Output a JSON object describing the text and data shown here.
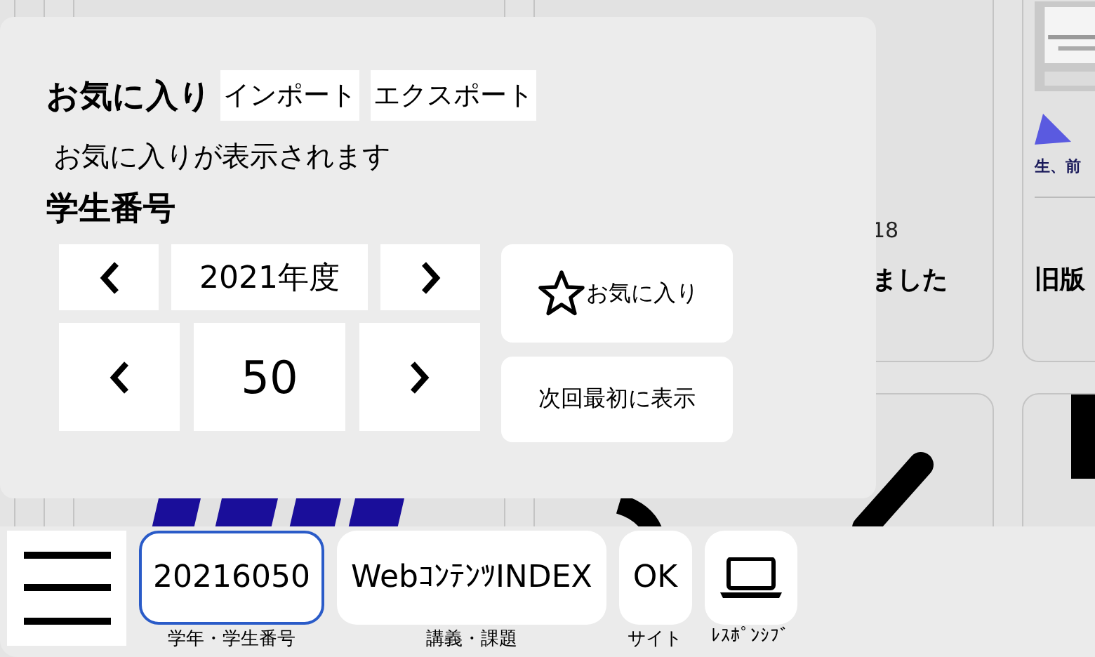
{
  "background": {
    "date_fragment": "18",
    "title_fragment": "ました",
    "card_title": "旧版",
    "caption_fragment": "生、前"
  },
  "favorites_panel": {
    "title": "お気に入り",
    "actions": [
      "インポート",
      "エクスポート"
    ],
    "message": "お気に入りが表示されます",
    "student_number": {
      "label": "学生番号",
      "year": "2021年度",
      "number": "50"
    },
    "favorite_button": "お気に入り",
    "show_first_button": "次回最初に表示"
  },
  "bottom_bar": [
    {
      "kind": "menu",
      "selected": false
    },
    {
      "kind": "text",
      "label": "20216050",
      "caption": "学年・学生番号",
      "selected": true
    },
    {
      "kind": "text",
      "label": "WebｺﾝﾃﾝﾂINDEX",
      "caption": "講義・課題",
      "selected": false
    },
    {
      "kind": "text",
      "label": "OK",
      "caption": "サイト",
      "selected": false
    },
    {
      "kind": "laptop",
      "caption": "ﾚｽﾎﾟﾝｼﾌﾞ",
      "selected": false
    }
  ]
}
